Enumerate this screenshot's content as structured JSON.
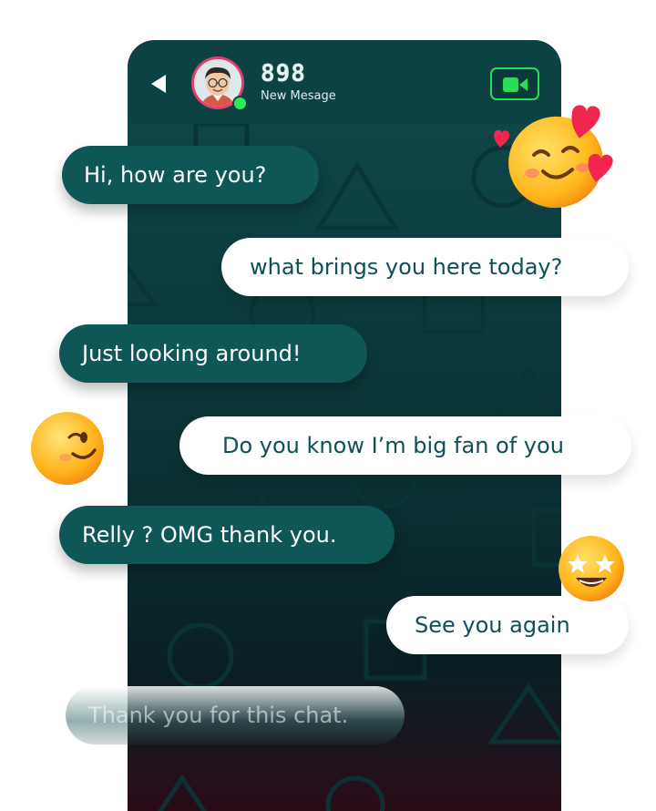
{
  "header": {
    "contact_name": "898",
    "status": "New Mesage",
    "back_icon": "back-arrow-icon",
    "video_icon": "video-camera-icon",
    "online": true
  },
  "messages": [
    {
      "side": "in",
      "text": "Hi, how are you?"
    },
    {
      "side": "out",
      "text": "what brings you here today?"
    },
    {
      "side": "in",
      "text": "Just looking around!"
    },
    {
      "side": "out",
      "text": "Do you know I’m big fan of you"
    },
    {
      "side": "in",
      "text": "Relly ?  OMG thank you."
    },
    {
      "side": "out",
      "text": "See you again"
    },
    {
      "side": "in",
      "text": "Thank you for this chat."
    }
  ],
  "emojis": [
    "smiling-face-with-hearts-emoji",
    "winking-face-emoji",
    "star-struck-face-emoji"
  ],
  "colors": {
    "incoming_bubble": "#0f5657",
    "outgoing_bubble": "#ffffff",
    "outgoing_text": "#0f4f55",
    "accent_green": "#2bdc5a",
    "avatar_ring": "#e0406a"
  }
}
